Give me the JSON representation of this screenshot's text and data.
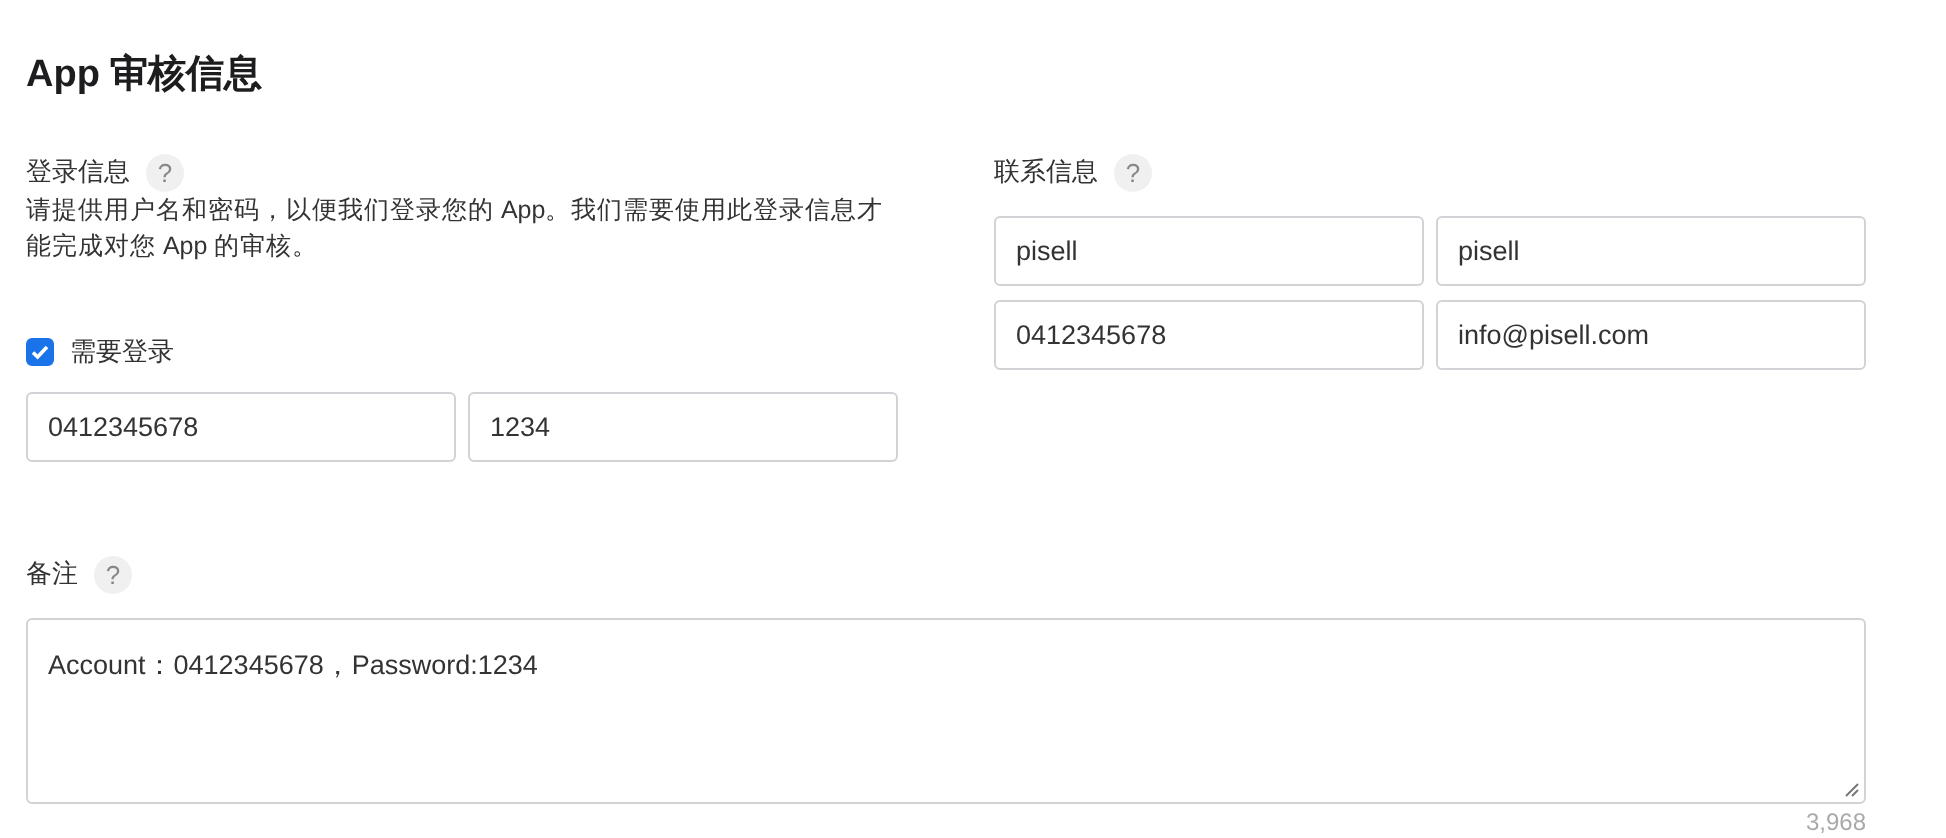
{
  "title": "App 审核信息",
  "sign_in": {
    "label": "登录信息",
    "help": "?",
    "description": "请提供用户名和密码，以便我们登录您的 App。我们需要使用此登录信息才能完成对您 App 的审核。",
    "requires_sign_in": {
      "label": "需要登录",
      "checked": true
    },
    "fields": [
      {
        "value": "0412345678"
      },
      {
        "value": "1234"
      }
    ]
  },
  "contact": {
    "label": "联系信息",
    "help": "?",
    "fields": [
      {
        "value": "pisell"
      },
      {
        "value": "pisell"
      },
      {
        "value": "0412345678"
      },
      {
        "value": "info@pisell.com"
      }
    ]
  },
  "notes": {
    "label": "备注",
    "help": "?",
    "value": "Account：0412345678，Password:1234",
    "counter": "3,968"
  }
}
